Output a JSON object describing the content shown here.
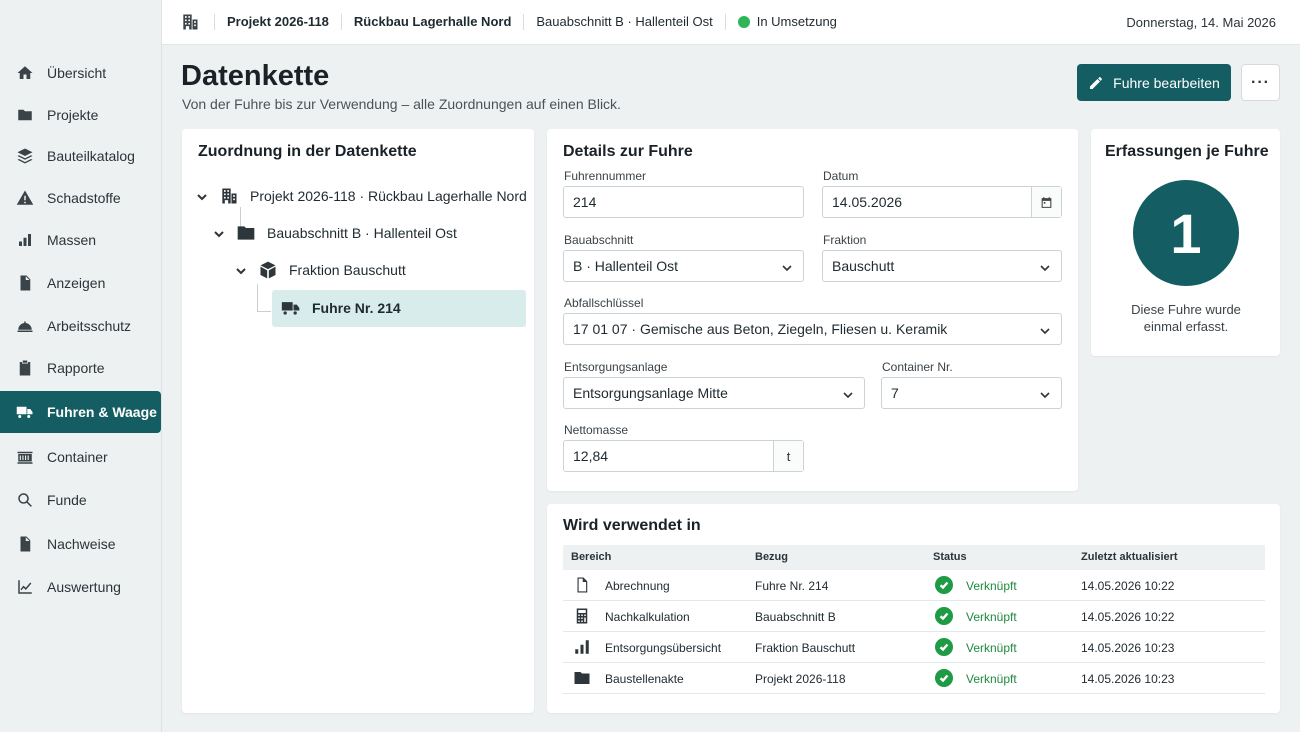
{
  "sidebar": {
    "items": [
      {
        "label": "Übersicht",
        "icon": "home-icon"
      },
      {
        "label": "Projekte",
        "icon": "folder-icon"
      },
      {
        "label": "Bauteilkatalog",
        "icon": "layers-icon"
      },
      {
        "label": "Schadstoffe",
        "icon": "warning-icon"
      },
      {
        "label": "Massen",
        "icon": "bar-chart-icon"
      },
      {
        "label": "Anzeigen",
        "icon": "document-icon"
      },
      {
        "label": "Arbeitsschutz",
        "icon": "helmet-icon"
      },
      {
        "label": "Rapporte",
        "icon": "clipboard-icon"
      },
      {
        "label": "Fuhren & Waage",
        "icon": "truck-icon",
        "active": true
      },
      {
        "label": "Container",
        "icon": "container-icon"
      },
      {
        "label": "Funde",
        "icon": "search-icon"
      },
      {
        "label": "Nachweise",
        "icon": "document-icon"
      },
      {
        "label": "Auswertung",
        "icon": "line-chart-icon"
      }
    ]
  },
  "topbar": {
    "project": "Projekt 2026-118",
    "project_name": "Rückbau Lagerhalle Nord",
    "section": "Bauabschnitt B · Hallenteil Ost",
    "status": "In Umsetzung",
    "status_color": "#2fb457",
    "date": "Donnerstag, 14. Mai 2026"
  },
  "page": {
    "title": "Datenkette",
    "subtitle": "Von der Fuhre bis zur Verwendung – alle Zuordnungen auf einen Blick.",
    "edit_button": "Fuhre bearbeiten",
    "more_button": "···"
  },
  "tree": {
    "title": "Zuordnung in der Datenkette",
    "nodes": [
      {
        "label": "Projekt 2026-118 · Rückbau Lagerhalle Nord",
        "icon": "building-icon"
      },
      {
        "label": "Bauabschnitt B · Hallenteil Ost",
        "icon": "folder-icon"
      },
      {
        "label": "Fraktion Bauschutt",
        "icon": "box-icon"
      },
      {
        "label": "Fuhre Nr. 214",
        "icon": "truck-icon",
        "selected": true
      }
    ]
  },
  "details": {
    "title": "Details zur Fuhre",
    "fuhrennummer_label": "Fuhrennummer",
    "fuhrennummer": "214",
    "datum_label": "Datum",
    "datum": "14.05.2026",
    "bauabschnitt_label": "Bauabschnitt",
    "bauabschnitt": "B · Hallenteil Ost",
    "fraktion_label": "Fraktion",
    "fraktion": "Bauschutt",
    "abfall_label": "Abfallschlüssel",
    "abfall": "17 01 07 · Gemische aus Beton, Ziegeln, Fliesen u. Keramik",
    "anlage_label": "Entsorgungsanlage",
    "anlage": "Entsorgungsanlage Mitte",
    "container_label": "Container Nr.",
    "container": "7",
    "netto_label": "Nettomasse",
    "netto": "12,84",
    "netto_unit": "t"
  },
  "count": {
    "title": "Erfassungen je Fuhre",
    "value": "1",
    "text_line1": "Diese Fuhre wurde",
    "text_line2": "einmal erfasst."
  },
  "usage": {
    "title": "Wird verwendet in",
    "headers": [
      "Bereich",
      "Bezug",
      "Status",
      "Zuletzt aktualisiert"
    ],
    "rows": [
      {
        "bereich": "Abrechnung",
        "icon": "document-icon",
        "bezug": "Fuhre Nr. 214",
        "status": "Verknüpft",
        "updated": "14.05.2026  10:22"
      },
      {
        "bereich": "Nachkalkulation",
        "icon": "calculator-icon",
        "bezug": "Bauabschnitt B",
        "status": "Verknüpft",
        "updated": "14.05.2026  10:22"
      },
      {
        "bereich": "Entsorgungsübersicht",
        "icon": "bar-chart-icon",
        "bezug": "Fraktion Bauschutt",
        "status": "Verknüpft",
        "updated": "14.05.2026  10:23"
      },
      {
        "bereich": "Baustellenakte",
        "icon": "folder-icon",
        "bezug": "Projekt 2026-118",
        "status": "Verknüpft",
        "updated": "14.05.2026  10:23"
      }
    ]
  }
}
